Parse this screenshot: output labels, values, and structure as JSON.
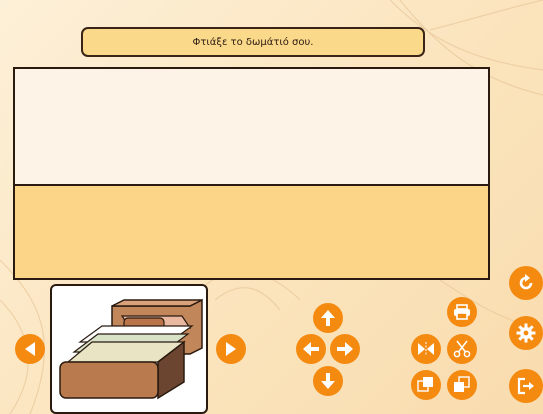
{
  "title": "Φτιάξε το δωμάτιό σου.",
  "icons": {
    "arrow_left": "chevron-left-icon",
    "arrow_right": "chevron-right-icon",
    "move_up": "arrow-up-icon",
    "move_down": "arrow-down-icon",
    "move_left": "arrow-left-icon",
    "move_right": "arrow-right-icon",
    "print": "printer-icon",
    "flip": "flip-horizontal-icon",
    "cut": "scissors-icon",
    "bring_forward": "layer-forward-icon",
    "send_backward": "layer-backward-icon",
    "reset": "refresh-icon",
    "settings": "gear-icon",
    "exit": "exit-icon"
  },
  "colors": {
    "button": "#f58a11",
    "title_bg": "#fbd98a",
    "floor": "#fdd588",
    "wall": "#fdf3e6"
  },
  "palette": {
    "selected_item": "bed"
  }
}
